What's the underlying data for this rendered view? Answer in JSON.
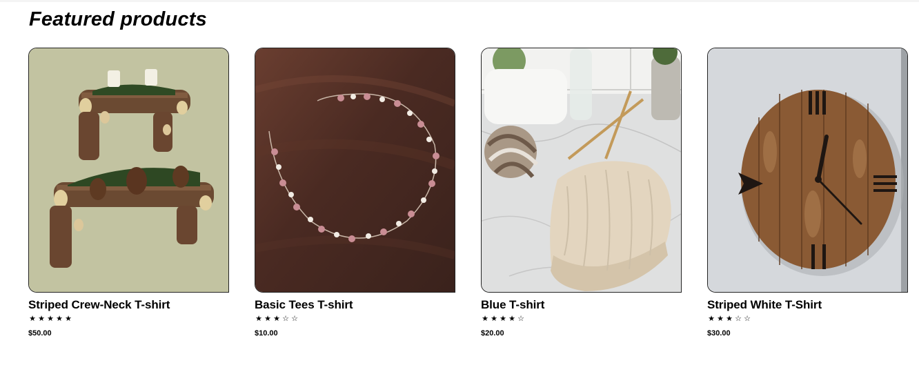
{
  "section": {
    "title": "Featured products"
  },
  "products": [
    {
      "name": "Striped Crew-Neck T-shirt",
      "rating": 5,
      "price": "$50.00",
      "image": "log-shelves-photo"
    },
    {
      "name": "Basic Tees T-shirt",
      "rating": 3,
      "price": "$10.00",
      "image": "beaded-hair-vine-photo"
    },
    {
      "name": "Blue T-shirt",
      "rating": 4,
      "price": "$20.00",
      "image": "knit-beanie-yarn-photo"
    },
    {
      "name": "Striped White T-Shirt",
      "rating": 3,
      "price": "$30.00",
      "image": "wooden-wall-clock-photo"
    }
  ],
  "rating_max": 5,
  "icons": {
    "star_filled": "star-filled-icon",
    "star_empty": "star-empty-icon"
  }
}
